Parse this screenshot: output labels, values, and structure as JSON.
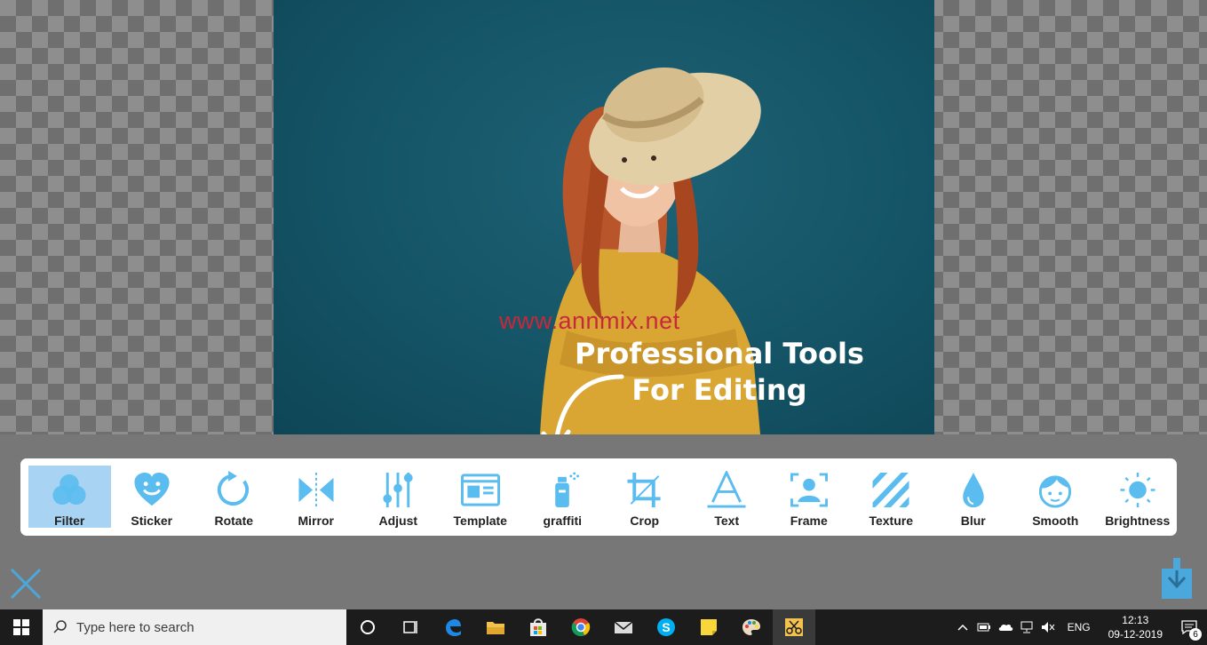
{
  "watermark": "www.annmix.net",
  "promo": {
    "line1": "Professional Tools",
    "line2": "For Editing"
  },
  "toolbar": {
    "tools": [
      {
        "label": "Filter",
        "icon": "filter-icon"
      },
      {
        "label": "Sticker",
        "icon": "sticker-icon"
      },
      {
        "label": "Rotate",
        "icon": "rotate-icon"
      },
      {
        "label": "Mirror",
        "icon": "mirror-icon"
      },
      {
        "label": "Adjust",
        "icon": "adjust-icon"
      },
      {
        "label": "Template",
        "icon": "template-icon"
      },
      {
        "label": "graffiti",
        "icon": "spray-can-icon"
      },
      {
        "label": "Crop",
        "icon": "crop-icon"
      },
      {
        "label": "Text",
        "icon": "text-icon"
      },
      {
        "label": "Frame",
        "icon": "frame-icon"
      },
      {
        "label": "Texture",
        "icon": "texture-icon"
      },
      {
        "label": "Blur",
        "icon": "blur-drop-icon"
      },
      {
        "label": "Smooth",
        "icon": "smooth-face-icon"
      },
      {
        "label": "Brightness",
        "icon": "brightness-icon"
      }
    ],
    "active_tool": "Filter"
  },
  "actions": {
    "close_icon": "close-icon",
    "save_icon": "save-download-icon"
  },
  "taskbar": {
    "search_placeholder": "Type here to search",
    "language": "ENG",
    "time": "12:13",
    "date": "09-12-2019",
    "notification_count": "6"
  },
  "colors": {
    "accent": "#5bbcf0",
    "active_tool_bg": "#a9d3f3",
    "photo_bg": "#145466",
    "watermark": "#c8283c"
  }
}
